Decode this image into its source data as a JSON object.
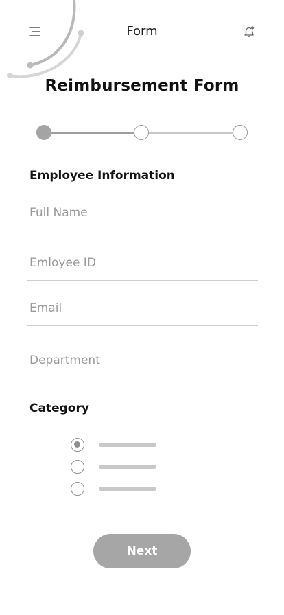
{
  "header": {
    "title": "Form",
    "menu_icon": "menu-icon",
    "notification_icon": "bell-icon"
  },
  "page_title": "Reimbursement Form",
  "stepper": {
    "steps": 3,
    "current_step": 1
  },
  "employee_section": {
    "title": "Employee Information",
    "fields": [
      {
        "placeholder": "Full Name",
        "value": ""
      },
      {
        "placeholder": "Emloyee ID",
        "value": ""
      },
      {
        "placeholder": "Email",
        "value": ""
      },
      {
        "placeholder": "Department",
        "value": ""
      }
    ]
  },
  "category_section": {
    "title": "Category",
    "selected_index": 0,
    "options_count": 3
  },
  "next_button": {
    "label": "Next"
  },
  "colors": {
    "accent_gray": "#a6a6a6",
    "text_dark": "#111111",
    "placeholder": "#9a9a9a",
    "divider": "#cfcfcf"
  }
}
